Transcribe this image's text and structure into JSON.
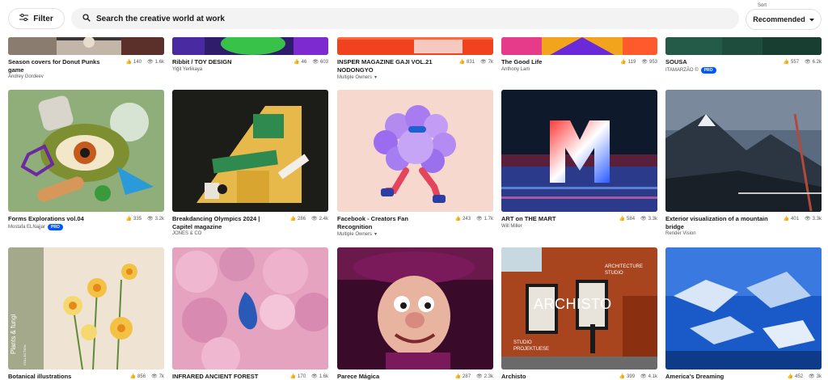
{
  "header": {
    "filter_label": "Filter",
    "search_placeholder": "Search the creative world at work",
    "sort_caption": "Sort",
    "sort_value": "Recommended"
  },
  "icons": {
    "filter": "sliders-icon",
    "search": "search-icon",
    "dropdown": "chevron-down-icon",
    "likes": "thumbs-up-icon",
    "views": "eye-icon"
  },
  "colors": {
    "pro_badge": "#0057ff",
    "search_bg": "#f3f3f3"
  },
  "projects": [
    {
      "title": "Season covers for Donut Punks game",
      "owner": "Andrey Gordeev",
      "likes": "140",
      "views": "1.6k",
      "pro": false,
      "multiple": false
    },
    {
      "title": "Ribbit / TOY DESIGN",
      "owner": "Yiğit Yerlikaya",
      "likes": "46",
      "views": "603",
      "pro": false,
      "multiple": false
    },
    {
      "title": "INSPER MAGAZINE GAJI VOL.21 NODONGYO",
      "owner": "Multiple Owners",
      "likes": "831",
      "views": "7k",
      "pro": false,
      "multiple": true
    },
    {
      "title": "The Good Life",
      "owner": "Anthony Lam",
      "likes": "119",
      "views": "953",
      "pro": false,
      "multiple": false
    },
    {
      "title": "SOUSA",
      "owner": "ITAMARZÃO ©",
      "likes": "557",
      "views": "6.2k",
      "pro": true,
      "multiple": false
    },
    {
      "title": "Forms Explorations vol.04",
      "owner": "Mostafa ELNajjar",
      "likes": "335",
      "views": "3.2k",
      "pro": true,
      "multiple": false
    },
    {
      "title": "Breakdancing Olympics 2024 | Capitel magazine",
      "owner": "JONES & CO",
      "likes": "286",
      "views": "2.4k",
      "pro": false,
      "multiple": false
    },
    {
      "title": "Facebook - Creators Fan Recognition",
      "owner": "Multiple Owners",
      "likes": "243",
      "views": "1.7k",
      "pro": false,
      "multiple": true
    },
    {
      "title": "ART on THE MART",
      "owner": "Will Miller",
      "likes": "584",
      "views": "3.3k",
      "pro": false,
      "multiple": false
    },
    {
      "title": "Exterior visualization of a mountain bridge",
      "owner": "Render Vision",
      "likes": "401",
      "views": "3.3k",
      "pro": false,
      "multiple": false
    },
    {
      "title": "Botanical illustrations",
      "owner": "",
      "likes": "856",
      "views": "7k",
      "pro": false,
      "multiple": false
    },
    {
      "title": "INFRARED ANCIENT FOREST",
      "owner": "",
      "likes": "170",
      "views": "1.6k",
      "pro": false,
      "multiple": false
    },
    {
      "title": "Parece Mágica",
      "owner": "",
      "likes": "287",
      "views": "2.3k",
      "pro": false,
      "multiple": false
    },
    {
      "title": "Archisto",
      "owner": "",
      "likes": "399",
      "views": "4.1k",
      "pro": false,
      "multiple": false
    },
    {
      "title": "America's Dreaming",
      "owner": "",
      "likes": "452",
      "views": "3k",
      "pro": false,
      "multiple": false
    }
  ],
  "thumb_text": {
    "plants": "Plants & fungi",
    "plants_sub": "COLLECTION",
    "archisto_main": "ARCHISTO",
    "archisto_top": "ARCHITECTURE STUDIO",
    "archisto_bottom": "STUDIO PROJEKTUESE"
  }
}
